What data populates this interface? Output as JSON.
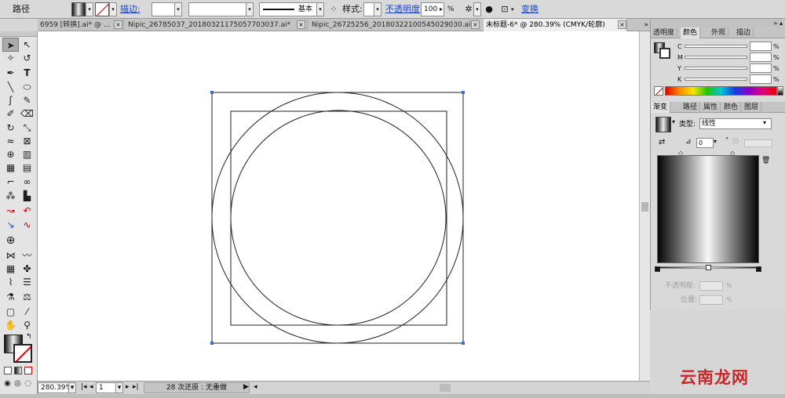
{
  "control_bar": {
    "object_type": "路径",
    "stroke_label": "描边:",
    "stroke_weight": "",
    "brush_definition": "基本",
    "style_label": "样式:",
    "opacity_label": "不透明度",
    "opacity_value": "100",
    "opacity_unit": "%",
    "transform_label": "变换"
  },
  "tabs": [
    {
      "label": "6959 [转换].ai* @ ..."
    },
    {
      "label": "Nipic_26785037_20180321175057703037.ai*"
    },
    {
      "label": "Nipic_26725256_20180322100545029030.ai*"
    },
    {
      "label": "未标题-6* @ 280.39% (CMYK/轮廓)"
    }
  ],
  "status_bar": {
    "zoom": "280.39%",
    "page": "1",
    "status_text": "28 次还原 : 无重做"
  },
  "color_panel": {
    "tabs": [
      "透明度",
      "颜色",
      "外观",
      "描边"
    ],
    "channels": [
      {
        "name": "C",
        "value": "",
        "unit": "%"
      },
      {
        "name": "M",
        "value": "",
        "unit": "%"
      },
      {
        "name": "Y",
        "value": "",
        "unit": "%"
      },
      {
        "name": "K",
        "value": "",
        "unit": "%"
      }
    ]
  },
  "gradient_panel": {
    "tabs": [
      "渐变",
      "路径",
      "属性",
      "颜色",
      "图层"
    ],
    "type_label": "类型:",
    "type_value": "线性",
    "angle_value": "0",
    "angle_unit": "°",
    "opacity_label": "不透明度:",
    "opacity_unit": "%",
    "position_label": "位置:",
    "position_unit": "%",
    "gradient_stops": [
      0.0,
      0.5,
      1.0
    ]
  },
  "watermark": "云南龙网",
  "colors": {
    "canvas": "#ffffff",
    "anchor": "#3b6fd8",
    "path": "#222222",
    "accent_red": "#c62828"
  }
}
